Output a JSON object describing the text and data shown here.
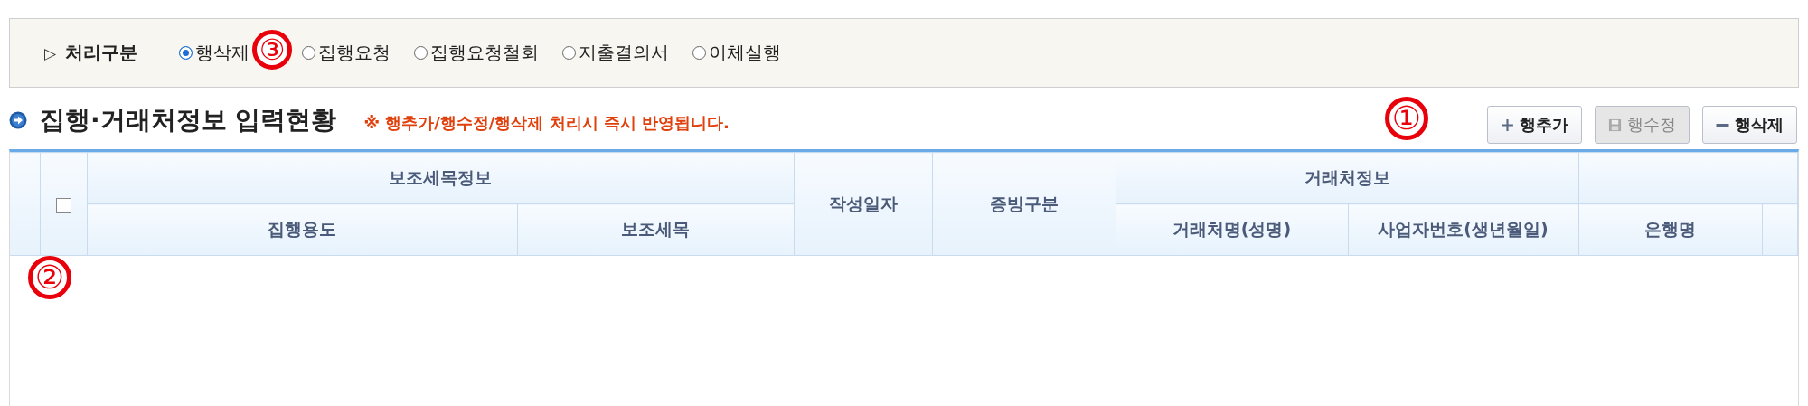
{
  "filter": {
    "label": "처리구분",
    "marker": "▷",
    "annotation": "③",
    "options": [
      {
        "label": "행삭제",
        "selected": true
      },
      {
        "label": "집행요청",
        "selected": false
      },
      {
        "label": "집행요청철회",
        "selected": false
      },
      {
        "label": "지출결의서",
        "selected": false
      },
      {
        "label": "이체실행",
        "selected": false
      }
    ]
  },
  "section": {
    "title": "집행·거래처정보 입력현황",
    "notice": "※ 행추가/행수정/행삭제 처리시 즉시 반영됩니다.",
    "annotation": "①"
  },
  "buttons": [
    {
      "kind": "add",
      "label": "행추가",
      "disabled": false
    },
    {
      "kind": "save",
      "label": "행수정",
      "disabled": true
    },
    {
      "kind": "remove",
      "label": "행삭제",
      "disabled": false
    }
  ],
  "table": {
    "annotation": "②",
    "select_all": {
      "checked": false
    },
    "groups": [
      {
        "label": "보조세목정보",
        "columns": [
          "집행용도",
          "보조세목"
        ]
      },
      {
        "label": "작성일자"
      },
      {
        "label": "증빙구분"
      },
      {
        "label": "거래처정보",
        "columns": [
          "거래처명(성명)",
          "사업자번호(생년월일)"
        ]
      },
      {
        "columns": [
          "은행명"
        ]
      }
    ]
  }
}
